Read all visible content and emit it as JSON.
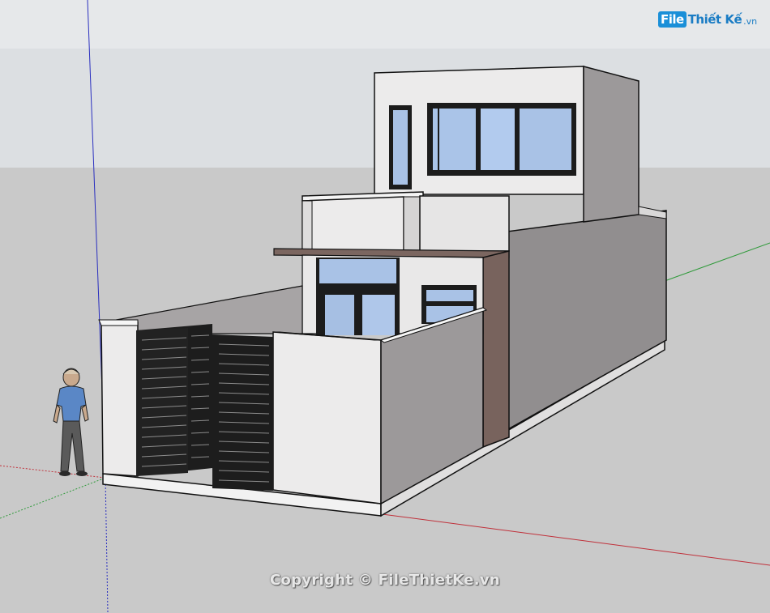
{
  "logo": {
    "file": "File",
    "text": "Thiết Kế",
    "ext": ".vn"
  },
  "watermark": "Copyright © FileThietKe.vn",
  "colors": {
    "sky": "#d9dcdf",
    "ground": "#c8c8c8",
    "wall_light": "#e8e6e6",
    "wall_shade": "#9b9899",
    "wall_side": "#8f8c8d",
    "glass": "#a9c2e6",
    "brown_beam": "#76615b",
    "axis_red": "#c0303a",
    "axis_green": "#2f9a3a",
    "axis_blue": "#2a2fbf"
  },
  "icons": {
    "scale_figure": "person-figure-icon"
  }
}
